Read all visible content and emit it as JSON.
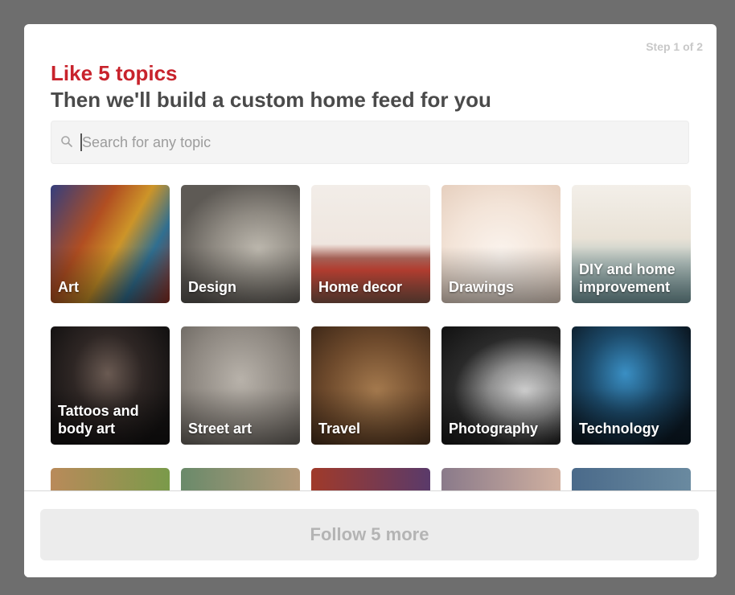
{
  "header": {
    "step": "Step 1 of 2",
    "headline": "Like 5 topics",
    "subheadline": "Then we'll build a custom home feed for you"
  },
  "search": {
    "placeholder": "Search for any topic",
    "icon": "search-icon"
  },
  "topics": [
    {
      "label": "Art"
    },
    {
      "label": "Design"
    },
    {
      "label": "Home decor"
    },
    {
      "label": "Drawings"
    },
    {
      "label": "DIY and home improvement"
    },
    {
      "label": "Tattoos and body art"
    },
    {
      "label": "Street art"
    },
    {
      "label": "Travel"
    },
    {
      "label": "Photography"
    },
    {
      "label": "Technology"
    }
  ],
  "footer": {
    "follow_label": "Follow 5 more"
  },
  "colors": {
    "accent": "#c8232c",
    "overlay": "#6e6e6e",
    "button_bg": "#ececec",
    "button_text": "#b4b4b4"
  }
}
